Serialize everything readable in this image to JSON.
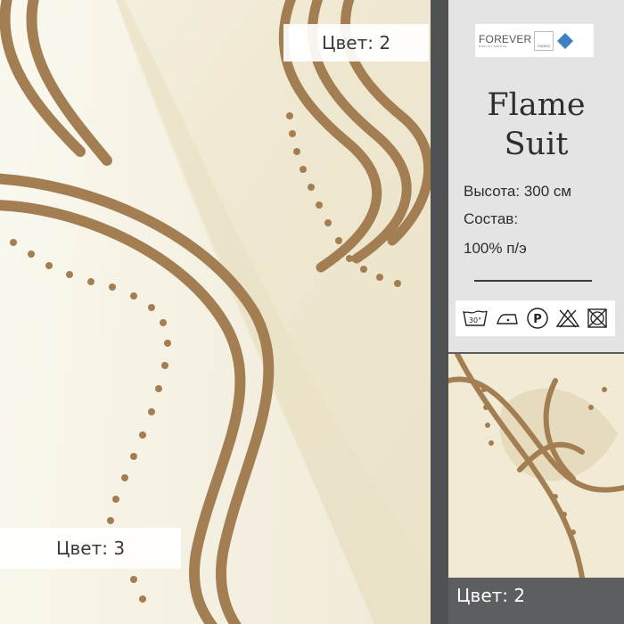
{
  "product": {
    "brand_main": "FOREVER",
    "brand_sub": "interior fabrics",
    "brand_fabric": "FABRIC",
    "title_line1": "Flame",
    "title_line2": "Suit",
    "height": "Высота: 300 см",
    "composition_label": "Состав:",
    "composition_value": "100% п/э"
  },
  "labels": {
    "top": "Цвет: 2",
    "bottom_left": "Цвет: 3",
    "bottom_right": "Цвет: 2"
  },
  "care": {
    "wash_temp": "30°",
    "dry_clean": "P",
    "icons": [
      "wash-30-icon",
      "iron-low-icon",
      "dry-clean-p-icon",
      "no-bleach-icon",
      "no-tumble-dry-icon"
    ]
  },
  "colors": {
    "panel": "#5d5e60",
    "panel_inner": "#e4e4e4",
    "fabric_cream": "#efe9d4",
    "embroidery": "#a07b50"
  }
}
